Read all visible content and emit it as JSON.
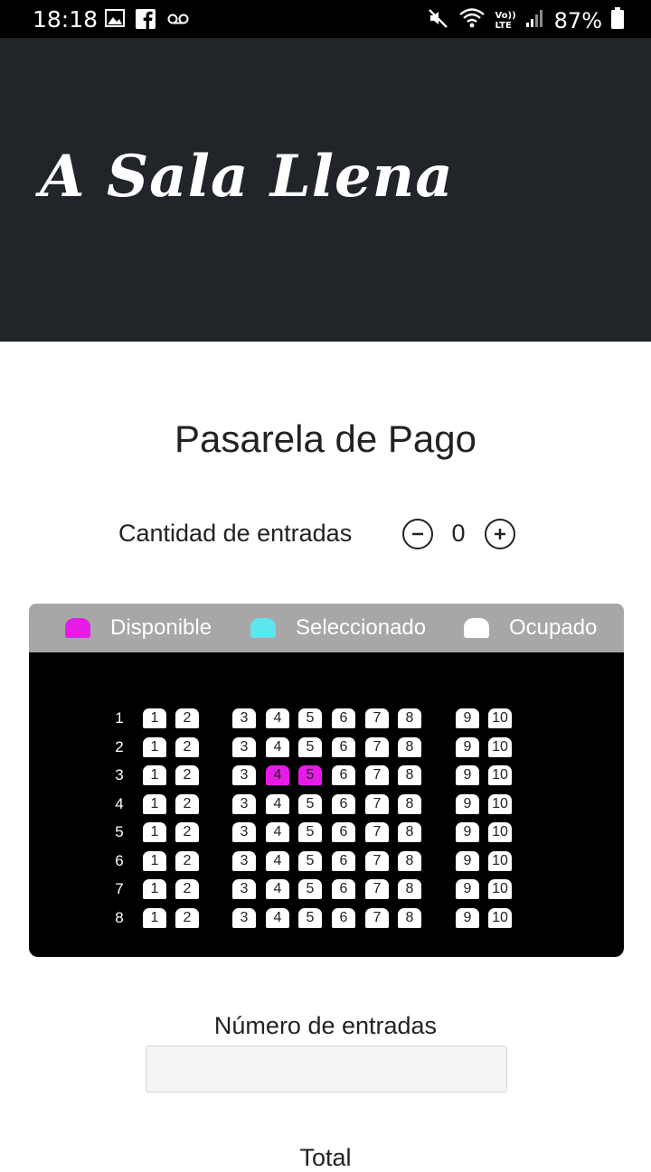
{
  "status_bar": {
    "time": "18:18",
    "battery": "87%",
    "left_icons": [
      "image-icon",
      "facebook-icon",
      "voicemail-icon"
    ],
    "right_icons": [
      "mute-icon",
      "wifi-icon",
      "volte-icon",
      "signal-icon",
      "battery-icon"
    ],
    "volte_line1": "Vo))",
    "volte_line2": "LTE"
  },
  "header": {
    "brand": "A Sala Llena"
  },
  "page": {
    "title": "Pasarela de Pago"
  },
  "quantity": {
    "label": "Cantidad de entradas",
    "value": "0"
  },
  "legend": [
    {
      "label": "Disponible",
      "color": "#e61be6"
    },
    {
      "label": "Seleccionado",
      "color": "#5de6ee"
    },
    {
      "label": "Ocupado",
      "color": "#ffffff"
    }
  ],
  "seating": {
    "rows": [
      "1",
      "2",
      "3",
      "4",
      "5",
      "6",
      "7",
      "8"
    ],
    "seats": [
      "1",
      "2",
      "3",
      "4",
      "5",
      "6",
      "7",
      "8",
      "9",
      "10"
    ],
    "highlighted": [
      {
        "row": "3",
        "seat": "4"
      },
      {
        "row": "3",
        "seat": "5"
      }
    ],
    "highlight_color": "#e61be6"
  },
  "form": {
    "tickets_label": "Número de entradas",
    "tickets_value": "",
    "total_label": "Total"
  }
}
